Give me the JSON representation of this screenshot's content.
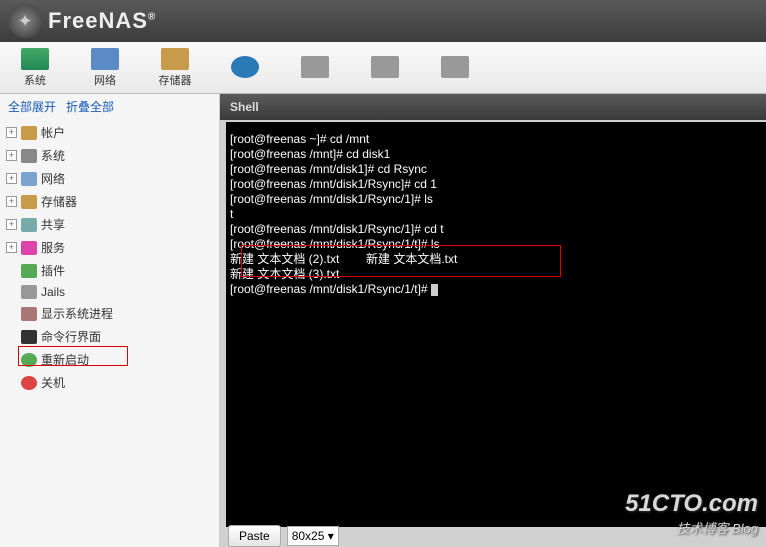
{
  "brand": "FreeNAS",
  "brand_reg": "®",
  "toolbar": [
    {
      "label": "系统"
    },
    {
      "label": "网络"
    },
    {
      "label": "存储器"
    },
    {
      "label": ""
    },
    {
      "label": ""
    },
    {
      "label": ""
    },
    {
      "label": ""
    }
  ],
  "side_links": {
    "expand": "全部展开",
    "collapse": "折叠全部"
  },
  "tree": [
    {
      "exp": "+",
      "label": "帐户",
      "cls": "acc"
    },
    {
      "exp": "+",
      "label": "系统",
      "cls": "sys"
    },
    {
      "exp": "+",
      "label": "网络",
      "cls": "net"
    },
    {
      "exp": "+",
      "label": "存储器",
      "cls": "stor"
    },
    {
      "exp": "+",
      "label": "共享",
      "cls": "share"
    },
    {
      "exp": "+",
      "label": "服务",
      "cls": "serv"
    },
    {
      "exp": "",
      "label": "插件",
      "cls": "plug"
    },
    {
      "exp": "",
      "label": "Jails",
      "cls": "jail"
    },
    {
      "exp": "",
      "label": "显示系统进程",
      "cls": "proc"
    },
    {
      "exp": "",
      "label": "命令行界面",
      "cls": "shell"
    },
    {
      "exp": "",
      "label": "重新启动",
      "cls": "reboot"
    },
    {
      "exp": "",
      "label": "关机",
      "cls": "shut"
    }
  ],
  "shell_title": "Shell",
  "terminal_lines": [
    "[root@freenas ~]# cd /mnt",
    "[root@freenas /mnt]# cd disk1",
    "[root@freenas /mnt/disk1]# cd Rsync",
    "[root@freenas /mnt/disk1/Rsync]# cd 1",
    "[root@freenas /mnt/disk1/Rsync/1]# ls",
    "t",
    "[root@freenas /mnt/disk1/Rsync/1]# cd t",
    "[root@freenas /mnt/disk1/Rsync/1/t]# ls",
    "新建 文本文档 (2).txt        新建 文本文档.txt",
    "新建 文本文档 (3).txt",
    "[root@freenas /mnt/disk1/Rsync/1/t]# "
  ],
  "paste_btn": "Paste",
  "size_sel": "80x25",
  "watermark": {
    "big": "51CTO.com",
    "sm": "技术博客  Blog"
  }
}
